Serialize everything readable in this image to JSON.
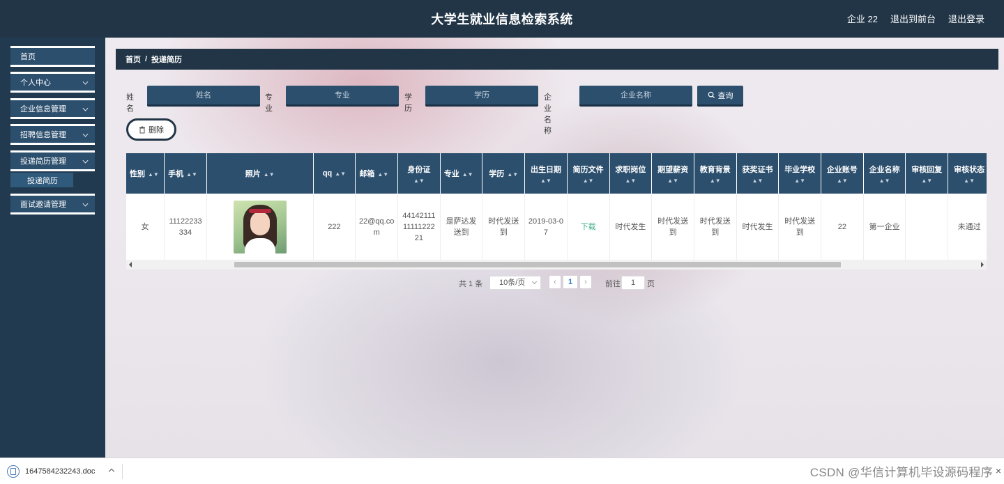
{
  "header": {
    "title": "大学生就业信息检索系统",
    "user": "企业 22",
    "to_front": "退出到前台",
    "logout": "退出登录"
  },
  "sidebar": {
    "items": [
      {
        "label": "首页"
      },
      {
        "label": "个人中心"
      },
      {
        "label": "企业信息管理"
      },
      {
        "label": "招聘信息管理"
      },
      {
        "label": "投递简历管理"
      },
      {
        "label": "面试邀请管理"
      }
    ],
    "submenu": "投递简历"
  },
  "breadcrumb": {
    "home": "首页",
    "sep": "/",
    "current": "投递简历"
  },
  "search": {
    "name_label": "姓名",
    "name_placeholder": "姓名",
    "major_label": "专业",
    "major_placeholder": "专业",
    "edu_label": "学历",
    "edu_placeholder": "学历",
    "company_label": "企业名称",
    "company_placeholder": "企业名称",
    "query_button": "查询"
  },
  "actions": {
    "delete_button": "删除"
  },
  "table": {
    "columns": [
      "性别",
      "手机",
      "照片",
      "qq",
      "邮箱",
      "身份证",
      "专业",
      "学历",
      "出生日期",
      "简历文件",
      "求职岗位",
      "期望薪资",
      "教育背景",
      "获奖证书",
      "毕业学校",
      "企业账号",
      "企业名称",
      "审核回复",
      "审核状态"
    ],
    "row": {
      "gender": "女",
      "phone": "11122233334",
      "qq": "222",
      "email": "22@qq.com",
      "idcard": "441421111111122221",
      "major": "是萨达发送到",
      "edu": "时代发送到",
      "birth": "2019-03-07",
      "resume": "下载",
      "position": "时代发生",
      "salary": "时代发送到",
      "education_bg": "时代发送到",
      "award": "时代发生",
      "school": "时代发送到",
      "company_account": "22",
      "company_name": "第一企业",
      "reply": "",
      "status": "未通过"
    }
  },
  "pagination": {
    "total": "共 1 条",
    "page_size": "10条/页",
    "current": "1",
    "goto_label": "前往",
    "goto_value": "1",
    "page_unit": "页"
  },
  "download": {
    "filename": "1647584232243.doc"
  },
  "watermark": "CSDN @华信计算机毕设源码程序"
}
